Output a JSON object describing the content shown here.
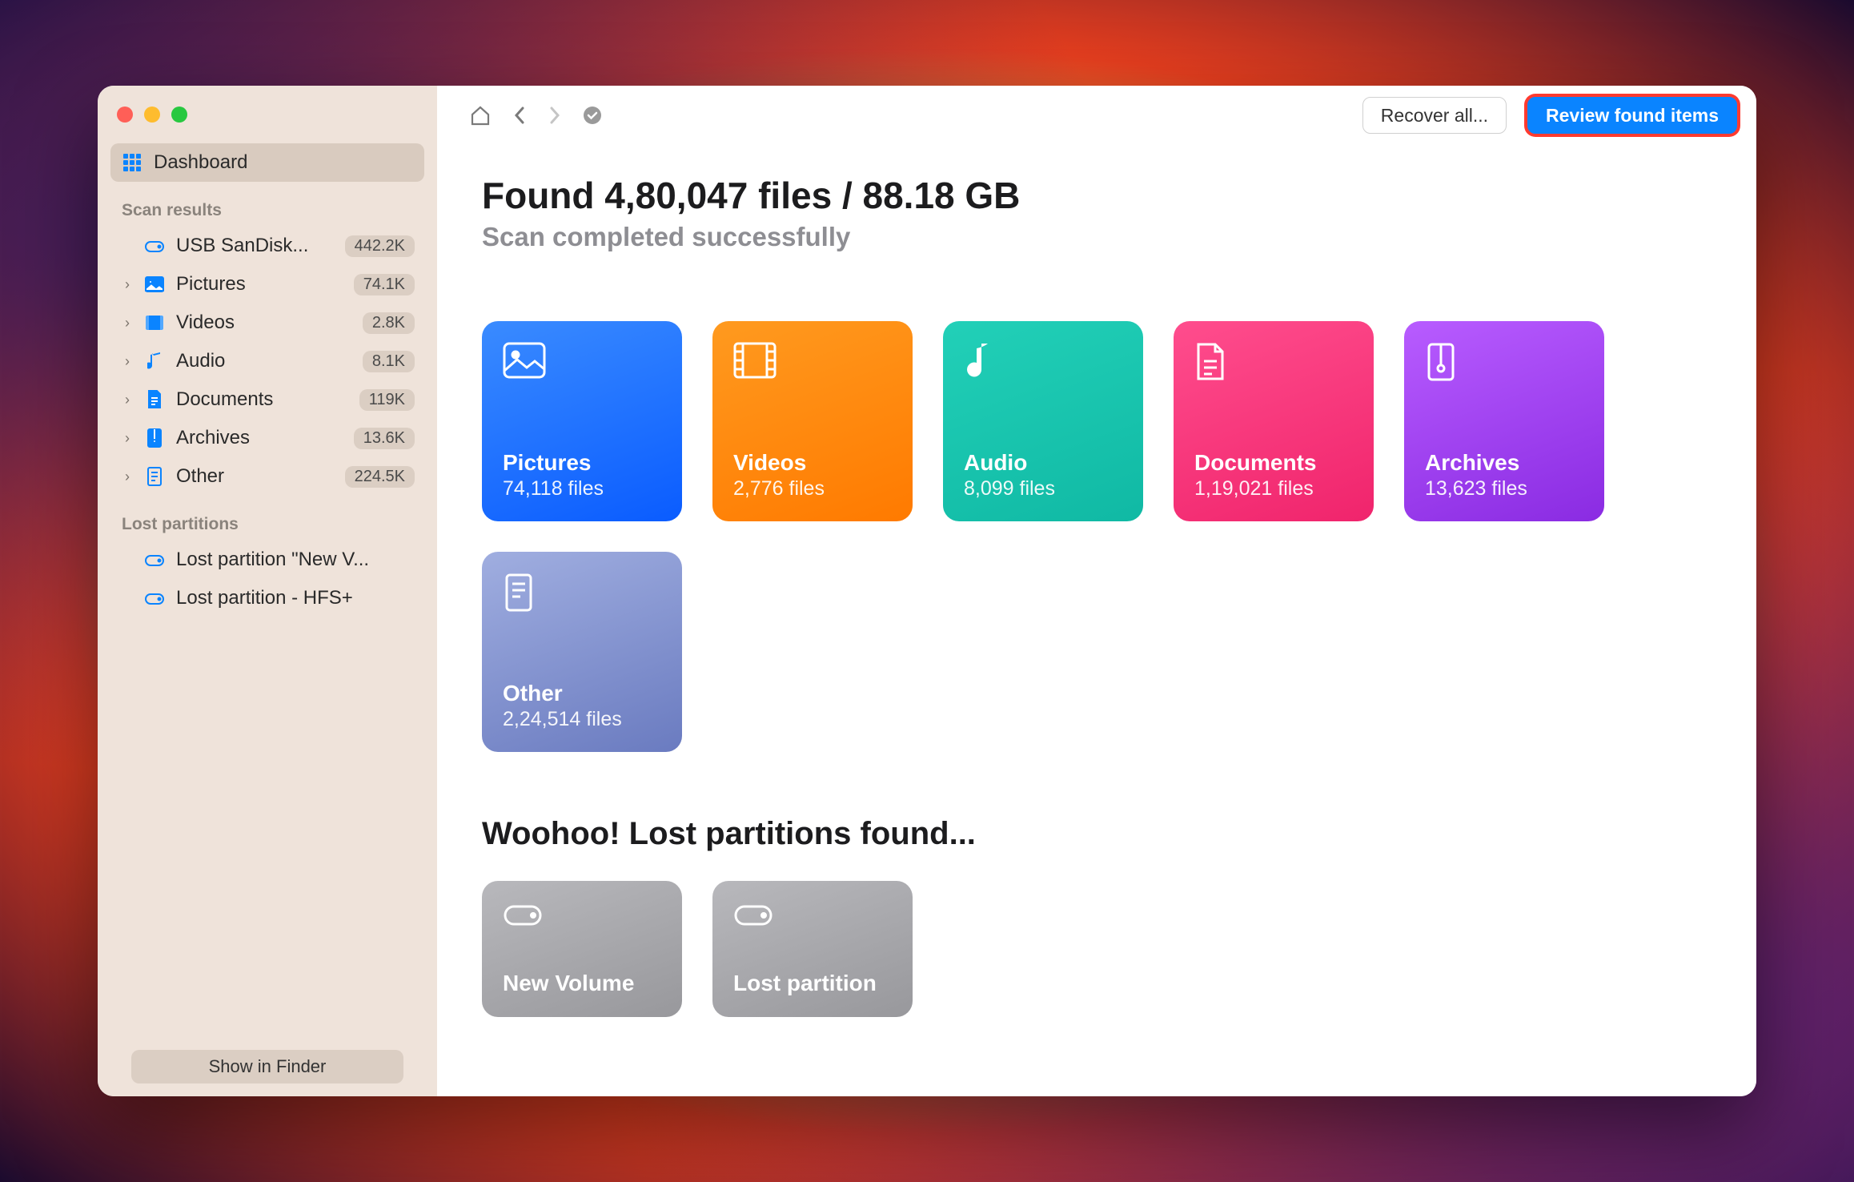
{
  "sidebar": {
    "dashboard_label": "Dashboard",
    "scan_results_header": "Scan results",
    "items": [
      {
        "label": "USB  SanDisk...",
        "count": "442.2K",
        "icon": "drive"
      },
      {
        "label": "Pictures",
        "count": "74.1K",
        "icon": "picture",
        "expandable": true
      },
      {
        "label": "Videos",
        "count": "2.8K",
        "icon": "video",
        "expandable": true
      },
      {
        "label": "Audio",
        "count": "8.1K",
        "icon": "audio",
        "expandable": true
      },
      {
        "label": "Documents",
        "count": "119K",
        "icon": "document",
        "expandable": true
      },
      {
        "label": "Archives",
        "count": "13.6K",
        "icon": "archive",
        "expandable": true
      },
      {
        "label": "Other",
        "count": "224.5K",
        "icon": "other",
        "expandable": true
      }
    ],
    "lost_partitions_header": "Lost partitions",
    "lost_partitions": [
      {
        "label": "Lost partition \"New V..."
      },
      {
        "label": "Lost partition - HFS+"
      }
    ],
    "footer_button": "Show in Finder"
  },
  "toolbar": {
    "recover_all": "Recover all...",
    "review": "Review found items"
  },
  "summary": {
    "heading": "Found 4,80,047 files / 88.18 GB",
    "subheading": "Scan completed successfully"
  },
  "categories": [
    {
      "key": "pictures",
      "title": "Pictures",
      "sub": "74,118 files"
    },
    {
      "key": "videos",
      "title": "Videos",
      "sub": "2,776 files"
    },
    {
      "key": "audio",
      "title": "Audio",
      "sub": "8,099 files"
    },
    {
      "key": "documents",
      "title": "Documents",
      "sub": "1,19,021 files"
    },
    {
      "key": "archives",
      "title": "Archives",
      "sub": "13,623 files"
    },
    {
      "key": "other",
      "title": "Other",
      "sub": "2,24,514 files"
    }
  ],
  "partitions_heading": "Woohoo! Lost partitions found...",
  "partitions": [
    {
      "title": "New Volume"
    },
    {
      "title": "Lost partition"
    }
  ]
}
